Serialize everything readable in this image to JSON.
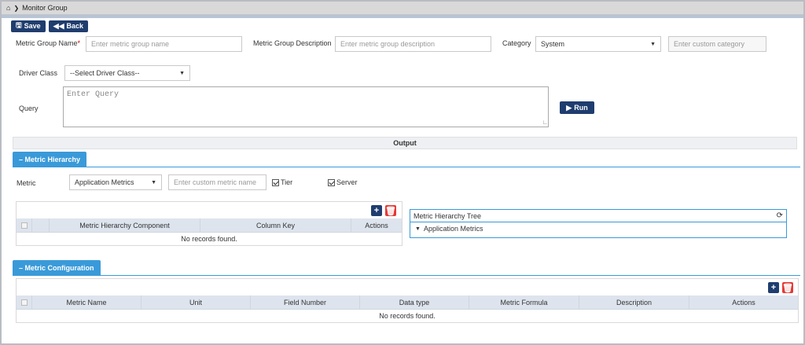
{
  "breadcrumb": {
    "home_icon": "home-icon",
    "separator_icon": "chevron-right-icon",
    "page": "Monitor Group"
  },
  "toolbar": {
    "save_label": "Save",
    "back_label": "Back"
  },
  "form": {
    "group_name_label": "Metric Group Name",
    "required_mark": "*",
    "group_name_placeholder": "Enter metric group name",
    "group_desc_label": "Metric Group Description",
    "group_desc_placeholder": "Enter metric group description",
    "category_label": "Category",
    "category_value": "System",
    "custom_category_placeholder": "Enter custom category",
    "driver_class_label": "Driver Class",
    "driver_class_value": "--Select Driver Class--",
    "query_label": "Query",
    "query_placeholder": "Enter Query",
    "run_label": "Run"
  },
  "output_label": "Output",
  "hierarchy": {
    "tab_label": "Metric Hierarchy",
    "metric_label": "Metric",
    "metric_value": "Application Metrics",
    "custom_metric_placeholder": "Enter custom metric name",
    "tier_label": "Tier",
    "server_label": "Server",
    "columns": [
      "Metric Hierarchy Component",
      "Column Key",
      "Actions"
    ],
    "empty_text": "No records found.",
    "tree_title": "Metric Hierarchy Tree",
    "tree_item": "Application Metrics"
  },
  "configuration": {
    "tab_label": "Metric Configuration",
    "columns": [
      "Metric Name",
      "Unit",
      "Field Number",
      "Data type",
      "Metric Formula",
      "Description",
      "Actions"
    ],
    "empty_text": "No records found."
  },
  "colors": {
    "primary": "#1f3d6e",
    "accent": "#3a9ad9",
    "danger": "#e53935"
  }
}
